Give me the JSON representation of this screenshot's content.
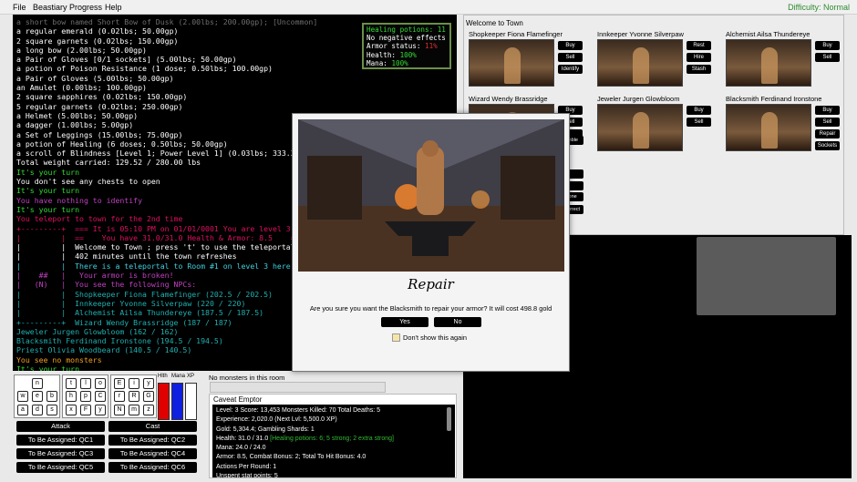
{
  "menu": {
    "file": "File",
    "beastiary": "Beastiary",
    "progress": "Progress",
    "help": "Help",
    "difficulty": "Difficulty: Normal"
  },
  "log": [
    {
      "t": "a short bow named Short Bow of Dusk (2.00lbs; 200.00gp); [Uncommon]",
      "c": "#6e6e6e"
    },
    {
      "t": "a regular emerald (0.02lbs; 50.00gp)",
      "c": "#ffffff"
    },
    {
      "t": "2 square garnets (0.02lbs; 150.00gp)",
      "c": "#ffffff"
    },
    {
      "t": "a long bow (2.00lbs; 50.00gp)",
      "c": "#ffffff"
    },
    {
      "t": "a Pair of Gloves [0/1 sockets] (5.00lbs; 50.00gp)",
      "c": "#ffffff"
    },
    {
      "t": "a potion of Poison Resistance (1 dose; 0.50lbs; 100.00gp)",
      "c": "#ffffff"
    },
    {
      "t": "a Pair of Gloves (5.00lbs; 50.00gp)",
      "c": "#ffffff"
    },
    {
      "t": "an Amulet (0.00lbs; 100.00gp)",
      "c": "#ffffff"
    },
    {
      "t": "2 square sapphires (0.02lbs; 150.00gp)",
      "c": "#ffffff"
    },
    {
      "t": "5 regular garnets (0.02lbs; 250.00gp)",
      "c": "#ffffff"
    },
    {
      "t": "a Helmet (5.00lbs; 50.00gp)",
      "c": "#ffffff"
    },
    {
      "t": "a dagger (1.00lbs; 5.00gp)",
      "c": "#ffffff"
    },
    {
      "t": "a Set of Leggings (15.00lbs; 75.00gp)",
      "c": "#ffffff"
    },
    {
      "t": "a potion of Healing (6 doses; 0.50lbs; 50.00gp)",
      "c": "#ffffff"
    },
    {
      "t": "a scroll of Blindness [Level 1; Power Level 1] (0.03lbs; 333.33gp)",
      "c": "#ffffff"
    },
    {
      "t": "Total weight carried: 129.52 / 280.00 lbs",
      "c": "#ffffff"
    },
    {
      "t": "It's your turn",
      "c": "#33dd33"
    },
    {
      "t": "You don't see any chests to open",
      "c": "#ffffff"
    },
    {
      "t": "It's your turn",
      "c": "#33dd33"
    },
    {
      "t": "You have nothing to identify",
      "c": "#c040c0"
    },
    {
      "t": "It's your turn",
      "c": "#33dd33"
    },
    {
      "t": "You teleport to town for the 2nd time",
      "c": "#e01060"
    },
    {
      "t": "+---------+  === It is 05:10 PM on 01/01/0001 You are level 3 ===",
      "c": "#e01060"
    },
    {
      "t": "|         |  ==    You have 31.0/31.0 Health & Armor: 8.5    ==",
      "c": "#e01060"
    },
    {
      "t": "|         |  Welcome to Town ; press 't' to use the teleportal out",
      "c": "#ffffff"
    },
    {
      "t": "|         |  402 minutes until the town refreshes",
      "c": "#ffffff"
    },
    {
      "t": "|         |  There is a teleportal to Room #1 on level 3 here",
      "c": "#40d0e0"
    },
    {
      "t": "|    ##   |   Your armor is broken!",
      "c": "#c040c0"
    },
    {
      "t": "|   (N)   |  You see the following NPCs:",
      "c": "#c040c0"
    },
    {
      "t": "|         |  Shopkeeper Fiona Flamefinger (202.5 / 202.5)",
      "c": "#20b0b0"
    },
    {
      "t": "|         |  Innkeeper Yvonne Silverpaw (220 / 220)",
      "c": "#20b0b0"
    },
    {
      "t": "|         |  Alchemist Ailsa Thundereye (187.5 / 187.5)",
      "c": "#20b0b0"
    },
    {
      "t": "+---------+  Wizard Wendy Brassridge (187 / 187)",
      "c": "#20b0b0"
    },
    {
      "t": "Jeweler Jurgen Glowbloom (162 / 162)",
      "c": "#20b0b0"
    },
    {
      "t": "Blacksmith Ferdinand Ironstone (194.5 / 194.5)",
      "c": "#20b0b0"
    },
    {
      "t": "Priest Olivia Woodbeard (140.5 / 140.5)",
      "c": "#20b0b0"
    },
    {
      "t": "You see no monsters",
      "c": "#f0a020"
    },
    {
      "t": "It's your turn",
      "c": "#33dd33"
    }
  ],
  "stats": [
    {
      "t": "Healing potions: 11",
      "c": "#33dd33"
    },
    {
      "t": "No negative effects",
      "c": "#ffffff"
    },
    {
      "t": "Armor status: ",
      "c": "#ffffff",
      "v": "11%",
      "vc": "#e03030"
    },
    {
      "t": "Health: ",
      "c": "#ffffff",
      "v": "100%",
      "vc": "#33dd33"
    },
    {
      "t": "Mana: ",
      "c": "#ffffff",
      "v": "100%",
      "vc": "#33dd33"
    }
  ],
  "keypad_left": [
    [
      "n"
    ],
    [
      "w",
      "e",
      "b"
    ],
    [
      "a",
      "d",
      "s"
    ],
    [
      "z",
      "c",
      "x"
    ]
  ],
  "bars": {
    "hlth": "Hlth",
    "mana": "Mana",
    "xp": "XP"
  },
  "actions": {
    "attack": "Attack",
    "cast": "Cast"
  },
  "quick": [
    "To Be Assigned: QC1",
    "To Be Assigned: QC2",
    "To Be Assigned: QC3",
    "To Be Assigned: QC4",
    "To Be Assigned: QC5",
    "To Be Assigned: QC6"
  ],
  "monsters_label": "No monsters in this room",
  "character": {
    "title": "Caveat Emptor",
    "lines": [
      "Level: 3    Score: 13,453    Monsters Killed: 70    Total Deaths: 5",
      "Experience: 2,020.0 (Next Lvl: 5,500.0 XP)",
      "Gold: 5,304.4; Gambling Shards: 1",
      "Health: 31.0 / 31.0",
      "Mana: 24.0 / 24.0",
      "Armor: 8.5, Combat Bonus: 2; Total To Hit Bonus: 4.0",
      "Actions Per Round: 1",
      "Unspent stat points: 5"
    ],
    "health_extra": "[Healing potions: 6; 5 strong; 2 extra strong]"
  },
  "town": {
    "title": "Welcome to Town",
    "npcs": [
      {
        "name": "Shopkeeper Fiona Flamefinger",
        "buttons": [
          "Buy",
          "Sell",
          "Identify"
        ]
      },
      {
        "name": "Innkeeper Yvonne Silverpaw",
        "buttons": [
          "Rest",
          "Hire",
          "Stash"
        ]
      },
      {
        "name": "Alchemist Ailsa Thundereye",
        "buttons": [
          "Buy",
          "Sell"
        ]
      },
      {
        "name": "Wizard Wendy Brassridge",
        "buttons": [
          "Buy",
          "Sell",
          ""
        ]
      },
      {
        "name": "Jeweler Jurgen Glowbloom",
        "buttons": [
          "Buy",
          "Sell"
        ]
      },
      {
        "name": "Blacksmith Ferdinand Ironstone",
        "buttons": [
          "Buy",
          "Sell",
          "Repair",
          "Sockets"
        ]
      }
    ],
    "partials": [
      "mble",
      "y",
      "l",
      "tone",
      "orrect"
    ]
  },
  "dialog": {
    "title": "Repair",
    "message": "Are you sure you want the Blacksmith to repair your armor? It will cost 498.8 gold",
    "yes": "Yes",
    "no": "No",
    "dont_show": "Don't show this again"
  }
}
